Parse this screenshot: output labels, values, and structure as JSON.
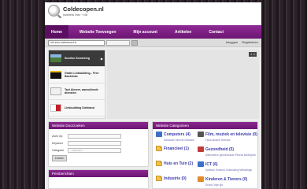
{
  "header": {
    "logo_title": "Coldecopen.nl",
    "logo_subtitle": "kwaliteits links + klik"
  },
  "nav": {
    "items": [
      {
        "label": "Home"
      },
      {
        "label": "Website Toevoegen"
      },
      {
        "label": "Mijn account"
      },
      {
        "label": "Artikelen"
      },
      {
        "label": "Contact"
      }
    ]
  },
  "searchbar": {
    "input_value": "Vul een zoekwoord in",
    "select_value": "",
    "login": "Inloggen",
    "register": "Registreren"
  },
  "featured": {
    "items": [
      {
        "title": "Sunrise Zomerring",
        "thumb_color": "#4a7a3a"
      },
      {
        "title": "Gratis Linkbuilding - Free Backlinks",
        "thumb_color": "#1a1a1a"
      },
      {
        "title": "Taxi Almere, aanvullende diensten",
        "thumb_color": "#d8d8d8"
      },
      {
        "title": "Linkbuilding Dofstand",
        "thumb_color": "#c81d25"
      }
    ],
    "counter": {
      "current": "1",
      "total": "1"
    }
  },
  "search_panel": {
    "title": "Website Doorzoeken",
    "fields": [
      {
        "label": "Zoek Op",
        "placeholder": ""
      },
      {
        "label": "Keyword",
        "placeholder": ""
      },
      {
        "label": "Categorie",
        "placeholder": "-- selecteer --"
      }
    ],
    "button": "Zoeken"
  },
  "news_panel": {
    "title": "Persberichten"
  },
  "categories": {
    "title": "Website Categorieen",
    "items": [
      {
        "name": "Computers (4)",
        "sub": "Hardware Internet Software",
        "icon": "computer-icon",
        "icon_color": "#3c6fc9"
      },
      {
        "name": "Film, muziek en televisie (0)",
        "sub": "Films Muziek Televisie",
        "icon": "film-icon",
        "icon_color": "#555555"
      },
      {
        "name": "Financieel (1)",
        "sub": "",
        "icon": "folder-icon",
        "icon_color": "#f2c24a"
      },
      {
        "name": "Gezondheid (5)",
        "sub": "Alternatieve geneeskunde Fitness Medicijnen",
        "icon": "health-icon",
        "icon_color": "#c23a3a"
      },
      {
        "name": "Huis en Tuin (2)",
        "sub": "",
        "icon": "folder-icon",
        "icon_color": "#f2c24a"
      },
      {
        "name": "ICT (6)",
        "sub": "Grafisch Ontwerp Linkbuilding Webdesign",
        "icon": "ict-icon",
        "icon_color": "#3c6fc9"
      },
      {
        "name": "Industrie (0)",
        "sub": "",
        "icon": "folder-icon",
        "icon_color": "#f2c24a"
      },
      {
        "name": "Kinderen & Tieners (0)",
        "sub": "School Vrije tijd",
        "icon": "kids-icon",
        "icon_color": "#e08a2a"
      }
    ]
  }
}
